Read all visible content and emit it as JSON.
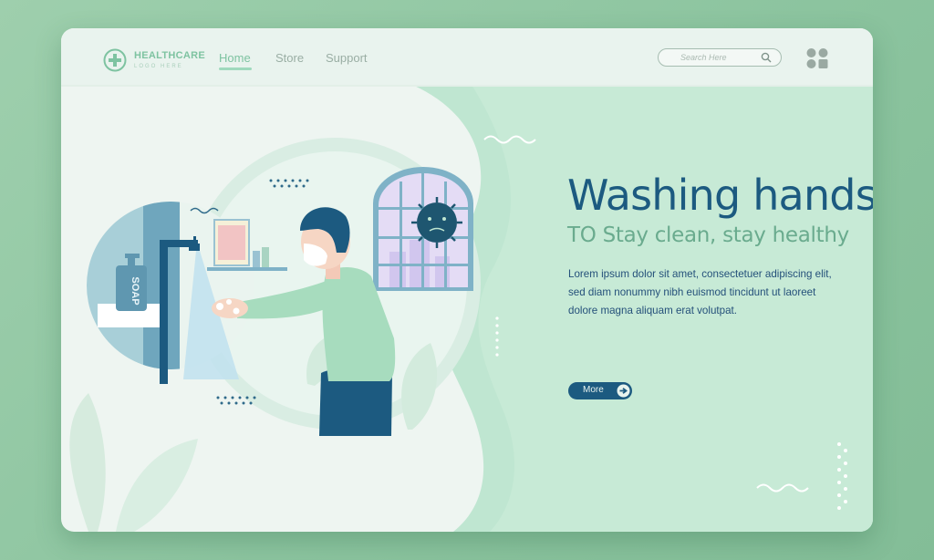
{
  "brand": {
    "title": "HEALTHCARE",
    "subtitle": "LOGO HERE"
  },
  "nav": {
    "items": [
      {
        "label": "Home"
      },
      {
        "label": "Store"
      },
      {
        "label": "Support"
      }
    ]
  },
  "search": {
    "placeholder": "Search Here"
  },
  "hero": {
    "title": "Washing hands",
    "subtitle": "TO Stay clean, stay healthy",
    "body": "Lorem ipsum dolor sit amet, consectetuer adipiscing elit, sed diam nonummy nibh euismod tincidunt ut laoreet dolore magna aliquam erat volutpat.",
    "button": "More"
  },
  "illustration": {
    "soap_label": "SOAP"
  },
  "colors": {
    "primary": "#1c5a80",
    "accent": "#7ec3a1",
    "background": "#8cc49f",
    "card": "#eef5f1"
  }
}
